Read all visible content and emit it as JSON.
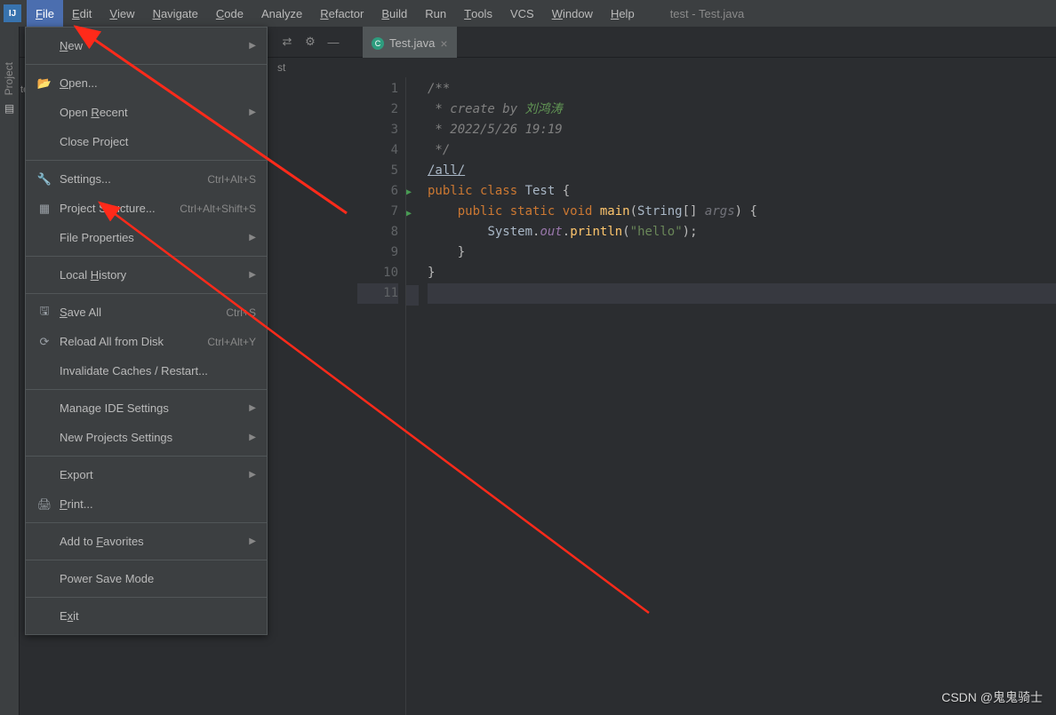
{
  "window": {
    "title": "test - Test.java"
  },
  "menubar": [
    {
      "label": "File",
      "u": "F",
      "active": true
    },
    {
      "label": "Edit",
      "u": "E"
    },
    {
      "label": "View",
      "u": "V"
    },
    {
      "label": "Navigate",
      "u": "N"
    },
    {
      "label": "Code",
      "u": "C"
    },
    {
      "label": "Analyze",
      "u": ""
    },
    {
      "label": "Refactor",
      "u": "R"
    },
    {
      "label": "Build",
      "u": "B"
    },
    {
      "label": "Run",
      "u": ""
    },
    {
      "label": "Tools",
      "u": "T"
    },
    {
      "label": "VCS",
      "u": ""
    },
    {
      "label": "Window",
      "u": "W"
    },
    {
      "label": "Help",
      "u": "H"
    }
  ],
  "sidebar": {
    "label": "Project"
  },
  "dropdown": [
    {
      "type": "item",
      "label": "New",
      "arrow": true,
      "u": "N"
    },
    {
      "type": "sep"
    },
    {
      "type": "item",
      "label": "Open...",
      "icon": "folder",
      "u": "O"
    },
    {
      "type": "item",
      "label": "Open Recent",
      "arrow": true,
      "u": "R"
    },
    {
      "type": "item",
      "label": "Close Project",
      "u": ""
    },
    {
      "type": "sep"
    },
    {
      "type": "item",
      "label": "Settings...",
      "icon": "wrench",
      "shortcut": "Ctrl+Alt+S",
      "u": ""
    },
    {
      "type": "item",
      "label": "Project Structure...",
      "icon": "structure",
      "shortcut": "Ctrl+Alt+Shift+S",
      "u": ""
    },
    {
      "type": "item",
      "label": "File Properties",
      "arrow": true,
      "u": ""
    },
    {
      "type": "sep"
    },
    {
      "type": "item",
      "label": "Local History",
      "arrow": true,
      "u": "H"
    },
    {
      "type": "sep"
    },
    {
      "type": "item",
      "label": "Save All",
      "icon": "save",
      "shortcut": "Ctrl+S",
      "u": "S"
    },
    {
      "type": "item",
      "label": "Reload All from Disk",
      "icon": "reload",
      "shortcut": "Ctrl+Alt+Y",
      "u": ""
    },
    {
      "type": "item",
      "label": "Invalidate Caches / Restart...",
      "u": ""
    },
    {
      "type": "sep"
    },
    {
      "type": "item",
      "label": "Manage IDE Settings",
      "arrow": true,
      "u": ""
    },
    {
      "type": "item",
      "label": "New Projects Settings",
      "arrow": true,
      "u": ""
    },
    {
      "type": "sep"
    },
    {
      "type": "item",
      "label": "Export",
      "arrow": true,
      "u": ""
    },
    {
      "type": "item",
      "label": "Print...",
      "icon": "print",
      "u": "P"
    },
    {
      "type": "sep"
    },
    {
      "type": "item",
      "label": "Add to Favorites",
      "arrow": true,
      "u": "F"
    },
    {
      "type": "sep"
    },
    {
      "type": "item",
      "label": "Power Save Mode",
      "u": ""
    },
    {
      "type": "sep"
    },
    {
      "type": "item",
      "label": "Exit",
      "u": "x"
    }
  ],
  "breadcrumb": "st",
  "tab": {
    "label": "Test.java"
  },
  "code": {
    "lines": [
      "/**",
      " * create by 刘鸿涛",
      " * 2022/5/26 19:19",
      " */",
      "/all/",
      "public class Test {",
      "    public static void main(String[] args) {",
      "        System.out.println(\"hello\");",
      "    }",
      "}",
      ""
    ],
    "gutter": [
      "1",
      "2",
      "3",
      "4",
      "5",
      "6",
      "7",
      "8",
      "9",
      "10",
      "11"
    ]
  },
  "watermark": "CSDN @鬼鬼骑士"
}
